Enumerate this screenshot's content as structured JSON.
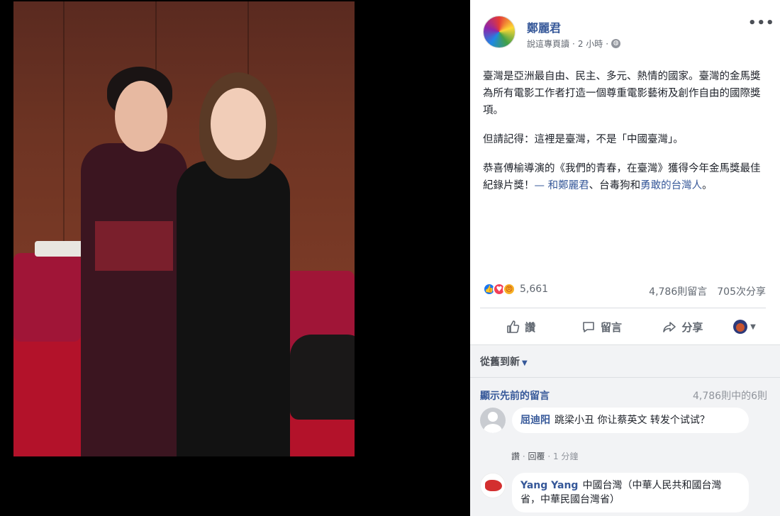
{
  "post": {
    "author": "鄭麗君",
    "translate_label": "說這專頁讀",
    "time": "2 小時",
    "more": "•••",
    "paragraphs": [
      "臺灣是亞洲最自由、民主、多元、熱情的國家。臺灣的金馬獎為所有電影工作者打造一個尊重電影藝術及創作自由的國際獎項。",
      "但請記得：這裡是臺灣，不是「中國臺灣」。"
    ],
    "para3": {
      "text": "恭喜傅榆導演的《我們的青春，在臺灣》獲得今年金馬獎最佳紀錄片獎！",
      "with_prefix": "— 和",
      "tag1": "鄭麗君",
      "sep": "、",
      "tag2": "台毒狗",
      "and": "和",
      "tag3": "勇敢的台灣人",
      "end": "。"
    }
  },
  "stats": {
    "reactions_count": "5,661",
    "comments": "4,786則留言",
    "shares": "705次分享"
  },
  "actions": {
    "like": "讚",
    "comment": "留言",
    "share": "分享"
  },
  "sort": {
    "label": "從舊到新"
  },
  "comments": {
    "prev_label": "顯示先前的留言",
    "count_label": "4,786則中的6則",
    "items": [
      {
        "name": "屈迪阳",
        "text": "跳梁小丑 你让蔡英文 转发个试试？",
        "like": "讚",
        "reply": "回覆",
        "time": "1 分鐘"
      },
      {
        "name": "Yang Yang",
        "text": "中國台灣（中華人民共和國台灣省，中華民國台灣省）"
      }
    ]
  },
  "colors": {
    "link": "#365899",
    "like_blue": "#1877f2",
    "love_red": "#f33e58"
  }
}
